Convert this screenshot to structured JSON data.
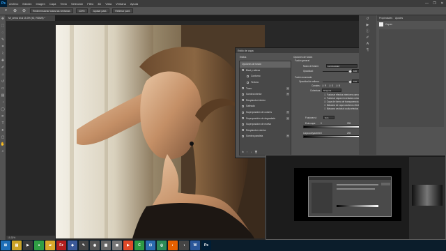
{
  "app": {
    "logo": "Ps"
  },
  "menubar": {
    "items": [
      "Archivo",
      "Edición",
      "Imagen",
      "Capa",
      "Texto",
      "Selección",
      "Filtro",
      "3D",
      "Vista",
      "Ventana",
      "Ayuda"
    ],
    "window_controls": [
      "—",
      "❐",
      "✕"
    ]
  },
  "options": {
    "sample_size_label": "Redimensionar todas las ventanas",
    "zoom": "100%",
    "fit_screen": "Ajustar pant.",
    "fill_screen": "Rellenar pant."
  },
  "document": {
    "tab": "Mi_cerna dl al 15.3% (IO, RGB/8) *",
    "status": "15.33%"
  },
  "dialog": {
    "title": "Estilo de capa",
    "styles_header": "Estilos",
    "styles": [
      {
        "label": "Opciones de fusión",
        "checkbox": false,
        "plus": false,
        "selected": true
      },
      {
        "label": "Bisel y relieve",
        "checkbox": true,
        "plus": false
      },
      {
        "label": "Contorno",
        "checkbox": true,
        "plus": false
      },
      {
        "label": "Textura",
        "checkbox": true,
        "plus": false
      },
      {
        "label": "Trazo",
        "checkbox": true,
        "plus": true
      },
      {
        "label": "Sombra interior",
        "checkbox": true,
        "plus": true
      },
      {
        "label": "Resplandor interior",
        "checkbox": true,
        "plus": false
      },
      {
        "label": "Satinado",
        "checkbox": true,
        "plus": false
      },
      {
        "label": "Superposición de colores",
        "checkbox": true,
        "plus": true
      },
      {
        "label": "Superposición de degradado",
        "checkbox": true,
        "plus": true
      },
      {
        "label": "Superposición de motivo",
        "checkbox": true,
        "plus": false
      },
      {
        "label": "Resplandor exterior",
        "checkbox": true,
        "plus": false
      },
      {
        "label": "Sombra paralela",
        "checkbox": true,
        "plus": true
      }
    ],
    "fx_icons": [
      "fx",
      "↑",
      "↓",
      "🗑"
    ],
    "section_title": "Opciones de fusión",
    "section_subtitle": "Fusión general",
    "blend_mode_label": "Modo de fusión:",
    "blend_mode_value": "Luminosidad",
    "opacity_label": "Opacidad:",
    "opacity_value": "100",
    "adv_title": "Fusión avanzada",
    "fill_opacity_label": "Opacidad de relleno:",
    "fill_opacity_value": "100",
    "channels_label": "Canales:",
    "channels": [
      "R",
      "G",
      "B"
    ],
    "knockout_label": "Cobertura:",
    "knockout_value": "Ninguna",
    "checks": [
      "Fusionar efectos interiores como un grupo",
      "Fusionar capas recortadas como un grupo",
      "Capa de forma de transparencia",
      "Máscara de capa oculta los efectos",
      "Máscara vectorial oculta efectos"
    ],
    "blend_if_label": "Fusionar si:",
    "blend_if_value": "Gris",
    "this_layer_label": "Esta capa:",
    "this_layer_low": "0",
    "this_layer_high": "255",
    "underlying_label": "Capa subyacente:",
    "underlying_low": "0",
    "underlying_high": "255",
    "buttons": {
      "ok": "OK",
      "cancel": "Cancelar",
      "new_style": "Estilo nuevo...",
      "preview": "Previsualizar"
    }
  },
  "panels": {
    "tabs": [
      "Propiedades",
      "Ajustes"
    ],
    "layer_label": "Capas",
    "mode": "Normal",
    "opacity": "100%"
  },
  "taskbar": {
    "icons": [
      {
        "name": "start-icon",
        "glyph": "⊞",
        "color": "#1e6fb8"
      },
      {
        "name": "explorer-icon",
        "glyph": "▤",
        "color": "#c9a227"
      },
      {
        "name": "media-icon",
        "glyph": "▶",
        "color": "#3a3a3a"
      },
      {
        "name": "chrome-icon",
        "glyph": "●",
        "color": "#2f9e44"
      },
      {
        "name": "folder-icon",
        "glyph": "▰",
        "color": "#d9a72b"
      },
      {
        "name": "filezilla-icon",
        "glyph": "Fz",
        "color": "#b21e1e"
      },
      {
        "name": "app-icon-1",
        "glyph": "◆",
        "color": "#3b5998"
      },
      {
        "name": "app-icon-2",
        "glyph": "✎",
        "color": "#444"
      },
      {
        "name": "app-icon-3",
        "glyph": "◉",
        "color": "#555"
      },
      {
        "name": "app-icon-4",
        "glyph": "▦",
        "color": "#666"
      },
      {
        "name": "app-icon-5",
        "glyph": "◼",
        "color": "#777"
      },
      {
        "name": "app-icon-6",
        "glyph": "▶",
        "color": "#e04a2a"
      },
      {
        "name": "camtasia-icon",
        "glyph": "C",
        "color": "#2e9a44"
      },
      {
        "name": "app-icon-7",
        "glyph": "⊡",
        "color": "#2b6cb0"
      },
      {
        "name": "app-icon-8",
        "glyph": "◎",
        "color": "#2e8b57"
      },
      {
        "name": "firefox-icon",
        "glyph": "◐",
        "color": "#e66000"
      },
      {
        "name": "app-icon-9",
        "glyph": "◑",
        "color": "#444"
      },
      {
        "name": "word-icon",
        "glyph": "W",
        "color": "#2b579a"
      },
      {
        "name": "photoshop-icon",
        "glyph": "Ps",
        "color": "#001e36"
      }
    ]
  }
}
